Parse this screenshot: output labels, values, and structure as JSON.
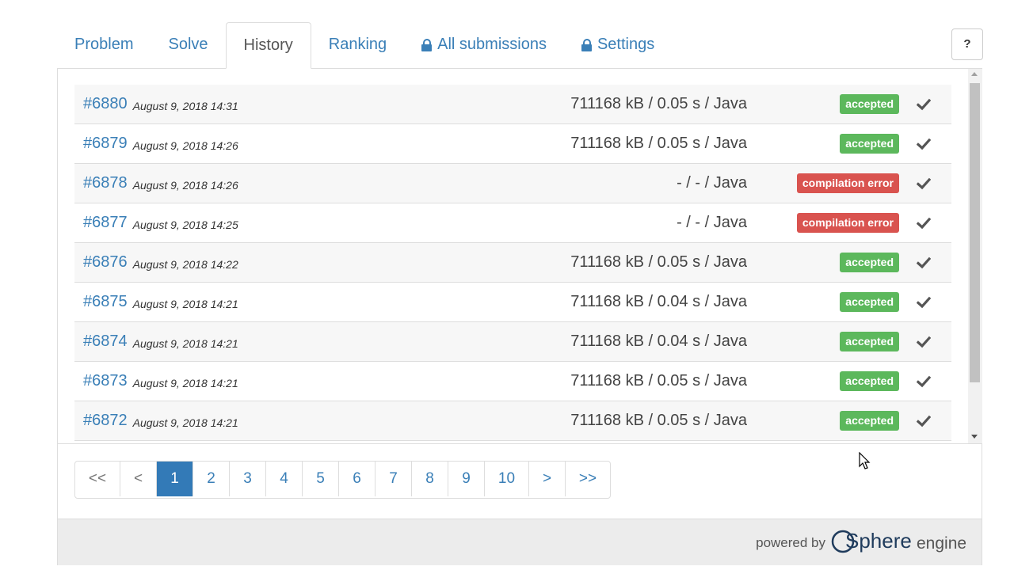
{
  "tabs": [
    {
      "label": "Problem",
      "locked": false,
      "active": false
    },
    {
      "label": "Solve",
      "locked": false,
      "active": false
    },
    {
      "label": "History",
      "locked": false,
      "active": true
    },
    {
      "label": "Ranking",
      "locked": false,
      "active": false
    },
    {
      "label": "All submissions",
      "locked": true,
      "active": false
    },
    {
      "label": "Settings",
      "locked": true,
      "active": false
    }
  ],
  "help_label": "?",
  "submissions": [
    {
      "id": "#6880",
      "date": "August 9, 2018 14:31",
      "result": "711168 kB / 0.05 s / Java",
      "status": "accepted",
      "status_type": "ok"
    },
    {
      "id": "#6879",
      "date": "August 9, 2018 14:26",
      "result": "711168 kB / 0.05 s / Java",
      "status": "accepted",
      "status_type": "ok"
    },
    {
      "id": "#6878",
      "date": "August 9, 2018 14:26",
      "result": "- / - / Java",
      "status": "compilation error",
      "status_type": "err"
    },
    {
      "id": "#6877",
      "date": "August 9, 2018 14:25",
      "result": "- / - / Java",
      "status": "compilation error",
      "status_type": "err"
    },
    {
      "id": "#6876",
      "date": "August 9, 2018 14:22",
      "result": "711168 kB / 0.05 s / Java",
      "status": "accepted",
      "status_type": "ok"
    },
    {
      "id": "#6875",
      "date": "August 9, 2018 14:21",
      "result": "711168 kB / 0.04 s / Java",
      "status": "accepted",
      "status_type": "ok"
    },
    {
      "id": "#6874",
      "date": "August 9, 2018 14:21",
      "result": "711168 kB / 0.04 s / Java",
      "status": "accepted",
      "status_type": "ok"
    },
    {
      "id": "#6873",
      "date": "August 9, 2018 14:21",
      "result": "711168 kB / 0.05 s / Java",
      "status": "accepted",
      "status_type": "ok"
    },
    {
      "id": "#6872",
      "date": "August 9, 2018 14:21",
      "result": "711168 kB / 0.05 s / Java",
      "status": "accepted",
      "status_type": "ok"
    }
  ],
  "pagination": {
    "first": "<<",
    "prev": "<",
    "pages": [
      "1",
      "2",
      "3",
      "4",
      "5",
      "6",
      "7",
      "8",
      "9",
      "10"
    ],
    "current": "1",
    "next": ">",
    "last": ">>"
  },
  "footer": {
    "powered_by": "powered by",
    "logo_text_main": "Sphere",
    "logo_text_sub": "engine"
  },
  "colors": {
    "link": "#3a7fb7",
    "accepted": "#5cb85c",
    "error": "#d9534f",
    "active_page": "#337ab7"
  }
}
